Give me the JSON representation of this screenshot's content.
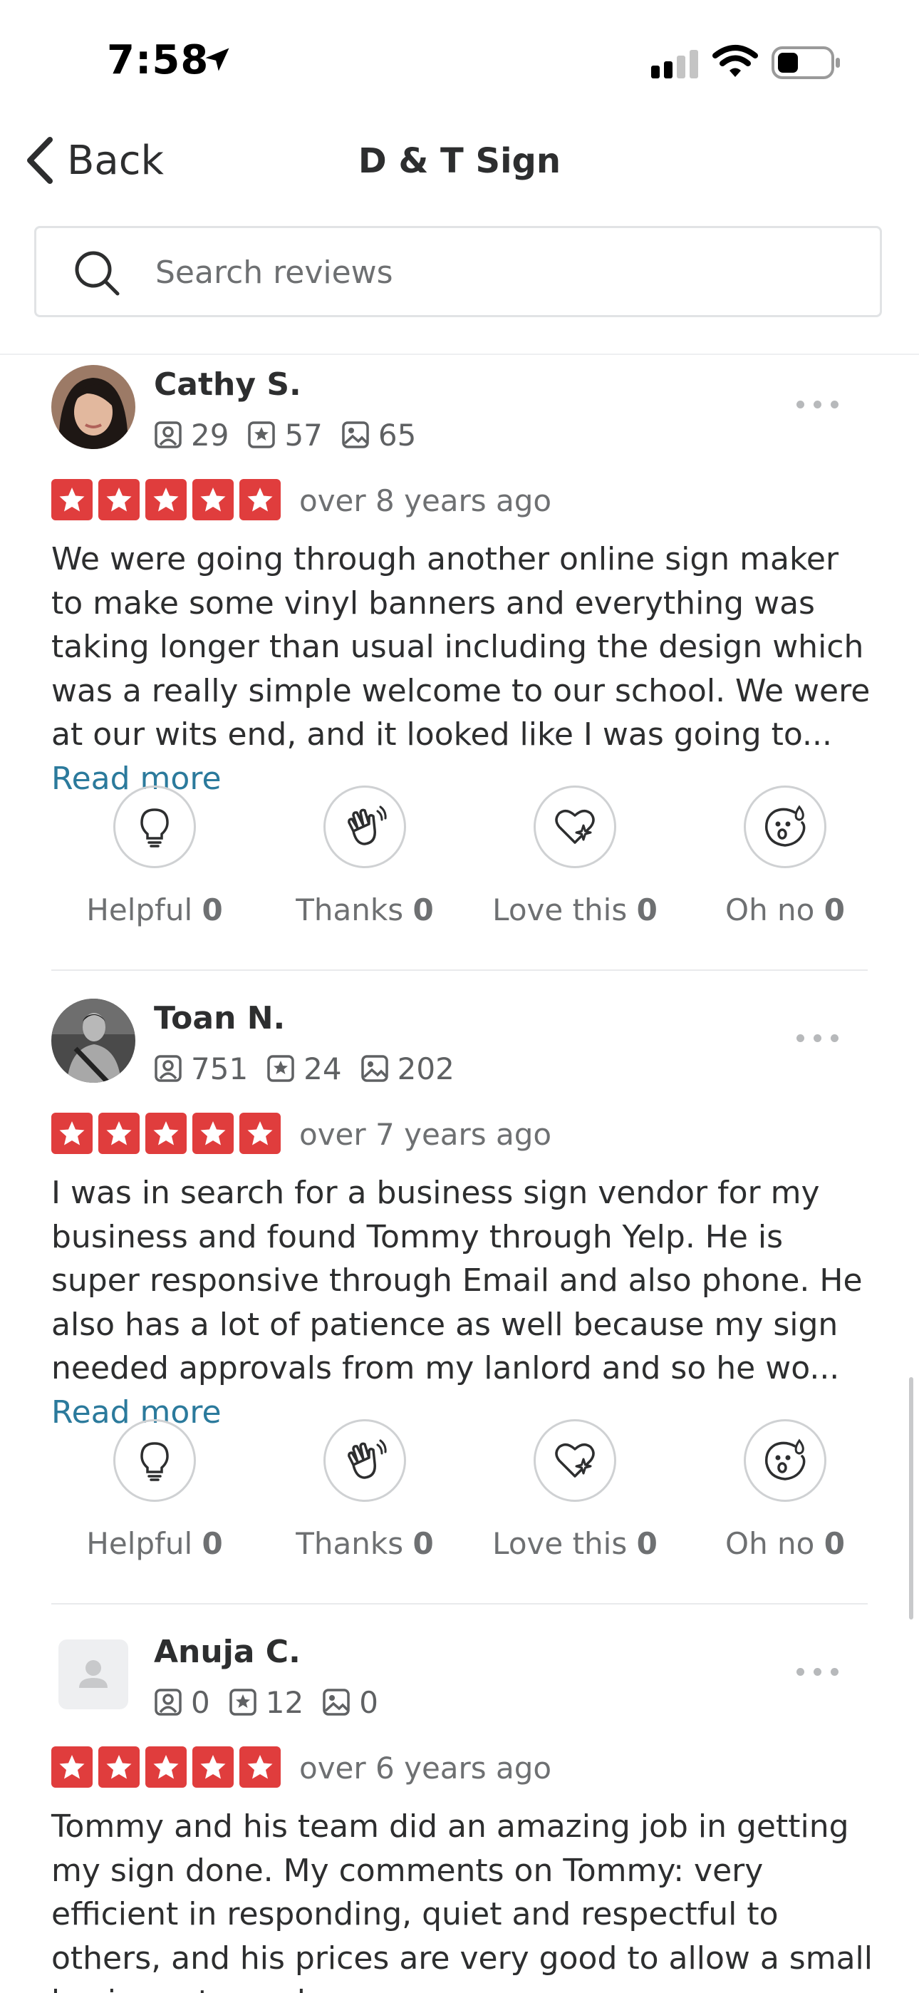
{
  "status_bar": {
    "time": "7:58"
  },
  "nav": {
    "back_label": "Back",
    "title": "D & T Sign"
  },
  "search": {
    "placeholder": "Search reviews",
    "value": ""
  },
  "reaction_labels": {
    "helpful": "Helpful",
    "thanks": "Thanks",
    "love": "Love this",
    "ohno": "Oh no"
  },
  "colors": {
    "star_red": "#e03d3d",
    "link_blue": "#2b7a9c"
  },
  "reviews": [
    {
      "name": "Cathy S.",
      "friends": "29",
      "reviews": "57",
      "photos": "65",
      "rating": 5,
      "date": "over 8 years ago",
      "text": "We were going through another online sign maker to make some vinyl banners and everything was taking longer than usual including the design which was a really simple welcome to our school. We were at our wits end, and it looked like I was going to...",
      "read_more": "Read more",
      "helpful": "0",
      "thanks": "0",
      "love": "0",
      "ohno": "0"
    },
    {
      "name": "Toan N.",
      "friends": "751",
      "reviews": "24",
      "photos": "202",
      "rating": 5,
      "date": "over 7 years ago",
      "text": "I was in search for a business sign vendor for my business and found Tommy through Yelp. He is super responsive through Email and also phone. He also has a lot of patience as well because my sign needed approvals from my lanlord and so he wo...",
      "read_more": "Read more",
      "helpful": "0",
      "thanks": "0",
      "love": "0",
      "ohno": "0"
    },
    {
      "name": "Anuja C.",
      "friends": "0",
      "reviews": "12",
      "photos": "0",
      "rating": 5,
      "date": "over 6 years ago",
      "text": "Tommy and his team did an amazing job in getting my sign done. My comments on Tommy: very efficient in responding, quiet and respectful to others, and his prices are very good to allow a small business to work"
    }
  ]
}
